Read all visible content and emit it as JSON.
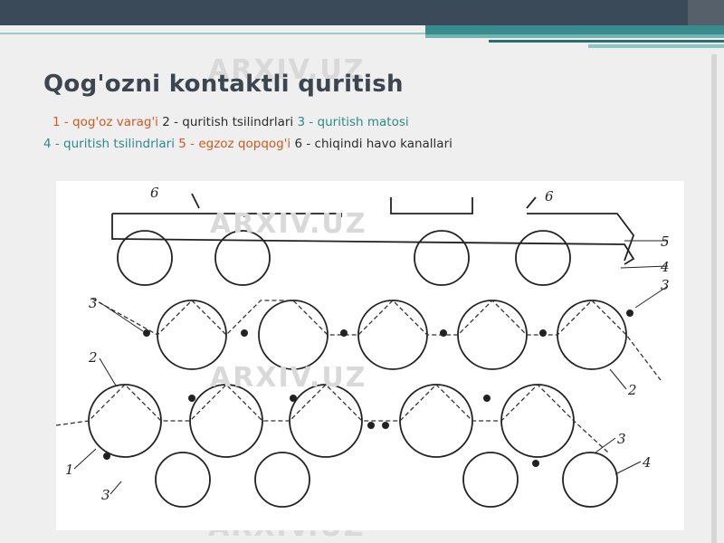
{
  "slide": {
    "title": "Qog'ozni kontaktli quritish",
    "legend": [
      {
        "text": "1 - qog'oz varag'i",
        "color": "#d05a1e"
      },
      {
        "text": "2 - quritish tsilindrlari",
        "color": "#2c2c2c"
      },
      {
        "text": "3 - quritish matosi",
        "color": "#2d8a8a"
      },
      {
        "text": "4 - quritish tsilindrlari",
        "color": "#2d8a8a"
      },
      {
        "text": "5 - egzoz qopqog'i",
        "color": "#d05a1e"
      },
      {
        "text": "6 - chiqindi",
        "color": "#2c2c2c"
      },
      {
        "text": "havo kanallari",
        "color": "#2c2c2c"
      }
    ],
    "watermark": "ARXIV.UZ"
  },
  "diagram": {
    "callouts": [
      "6",
      "6",
      "5",
      "4",
      "3",
      "3",
      "2",
      "2",
      "3",
      "4",
      "1",
      "3"
    ]
  },
  "colors": {
    "topbar": "#3b4a58",
    "accent_teal": "#3a8c8c",
    "title": "#3c4650"
  }
}
